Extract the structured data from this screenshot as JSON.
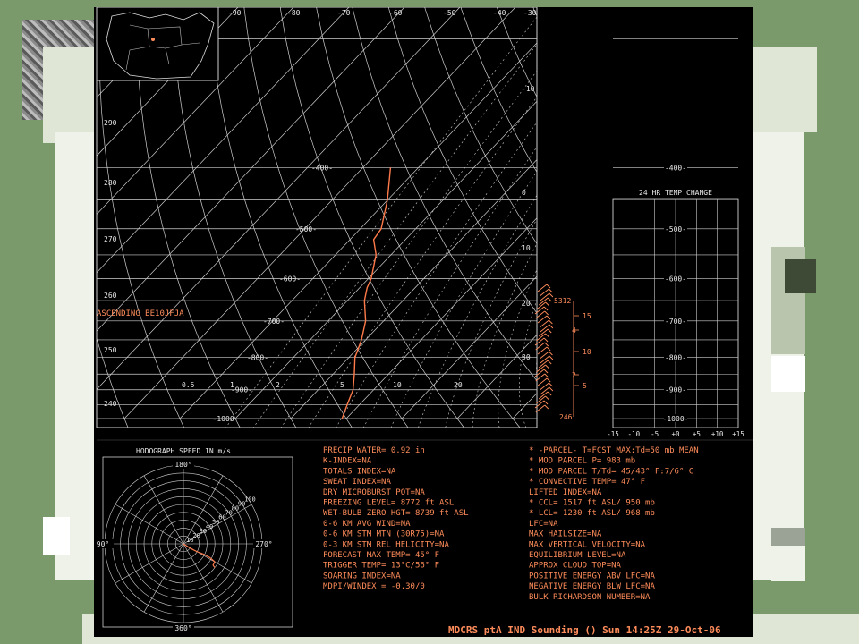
{
  "colors": {
    "background": "#7a9a6c",
    "screen": "#000000",
    "grid": "#cfcfcf",
    "text": "#ff8c5a",
    "profile": "#ff7a4a"
  },
  "chart_data": [
    {
      "type": "line",
      "name": "skew-t",
      "ascending_label": "ASCENDING   BE10JFJA",
      "pressure_levels": [
        "400",
        "500",
        "600",
        "700",
        "800",
        "900",
        "1000"
      ],
      "mixing_ratio_labels": [
        "0.5",
        "1",
        "2",
        "5",
        "10",
        "20"
      ],
      "temp_top_labels": [
        "-90",
        "-80",
        "-70",
        "-60",
        "-50",
        "-40",
        "-30"
      ],
      "temp_right_labels": [
        "-10",
        "0",
        "10",
        "20",
        "30"
      ],
      "theta_labels": [
        "290",
        "280",
        "270",
        "260",
        "250",
        "240"
      ],
      "temp_profile": [
        [
          400,
          -24
        ],
        [
          450,
          -20
        ],
        [
          500,
          -18
        ],
        [
          520,
          -14
        ],
        [
          550,
          -13
        ],
        [
          600,
          -9
        ],
        [
          620,
          -9
        ],
        [
          650,
          -7
        ],
        [
          700,
          -5
        ],
        [
          750,
          -3
        ],
        [
          800,
          -1
        ],
        [
          850,
          1
        ],
        [
          900,
          4
        ],
        [
          950,
          6
        ],
        [
          1000,
          8
        ]
      ],
      "height_labels": [
        "5312",
        "246"
      ],
      "km_labels": [
        "15",
        "4",
        "10",
        "2",
        "5"
      ]
    },
    {
      "type": "line",
      "name": "temp-change",
      "title": "24 HR TEMP CHANGE",
      "pressure_levels": [
        "400",
        "500",
        "600",
        "700",
        "800",
        "900",
        "1000"
      ],
      "x_ticks": [
        "-15",
        "-10",
        "-5",
        "+0",
        "+5",
        "+10",
        "+15"
      ]
    },
    {
      "type": "scatter",
      "name": "hodograph",
      "title": "HODOGRAPH SPEED IN m/s",
      "directions": [
        "180°",
        "90°",
        "270°",
        "360°"
      ],
      "speeds": [
        "10",
        "20",
        "30",
        "40",
        "50",
        "60",
        "70",
        "80",
        "90",
        "100"
      ],
      "trace": [
        [
          0,
          0
        ],
        [
          8,
          5
        ],
        [
          16,
          9
        ],
        [
          24,
          12
        ],
        [
          32,
          16
        ],
        [
          38,
          21
        ],
        [
          36,
          25
        ],
        [
          38,
          28
        ]
      ]
    }
  ],
  "indices_left": [
    "PRECIP WATER=  0.92 in",
    "K-INDEX=NA",
    "TOTALS INDEX=NA",
    "SWEAT  INDEX=NA",
    "DRY MICROBURST  POT=NA",
    "FREEZING LEVEL=  8772 ft ASL",
    "WET-BULB ZERO HGT= 8739 ft ASL",
    "0-6 KM AVG  WIND=NA",
    "0-6 KM STM MTN (30R75)=NA",
    "0-3 KM STM REL HELICITY=NA",
    "FORECAST  MAX TEMP= 45° F",
    "TRIGGER  TEMP= 13°C/56° F",
    "SOARING  INDEX=NA",
    "MDPI/WINDEX  = -0.30/0"
  ],
  "indices_right": [
    "* -PARCEL-  T=FCST  MAX:Td=50 mb MEAN",
    "* MOD PARCEL  P=  983 mb",
    "* MOD PARCEL  T/Td= 45/43° F:7/6° C",
    "* CONVECTIVE  TEMP=  47° F",
    "LIFTED  INDEX=NA",
    "* CCL=  1517  ft  ASL/  950 mb",
    "* LCL=  1230  ft  ASL/  968 mb",
    "LFC=NA",
    "MAX HAILSIZE=NA",
    "MAX VERTICAL  VELOCITY=NA",
    "EQUILIBRIUM  LEVEL=NA",
    "APPROX  CLOUD  TOP=NA",
    "POSITIVE  ENERGY  ABV  LFC=NA",
    "NEGATIVE  ENERGY  BLW  LFC=NA",
    "BULK  RICHARDSON  NUMBER=NA"
  ],
  "footer": "MDCRS ptA IND Sounding ()  Sun 14:25Z 29-Oct-06"
}
